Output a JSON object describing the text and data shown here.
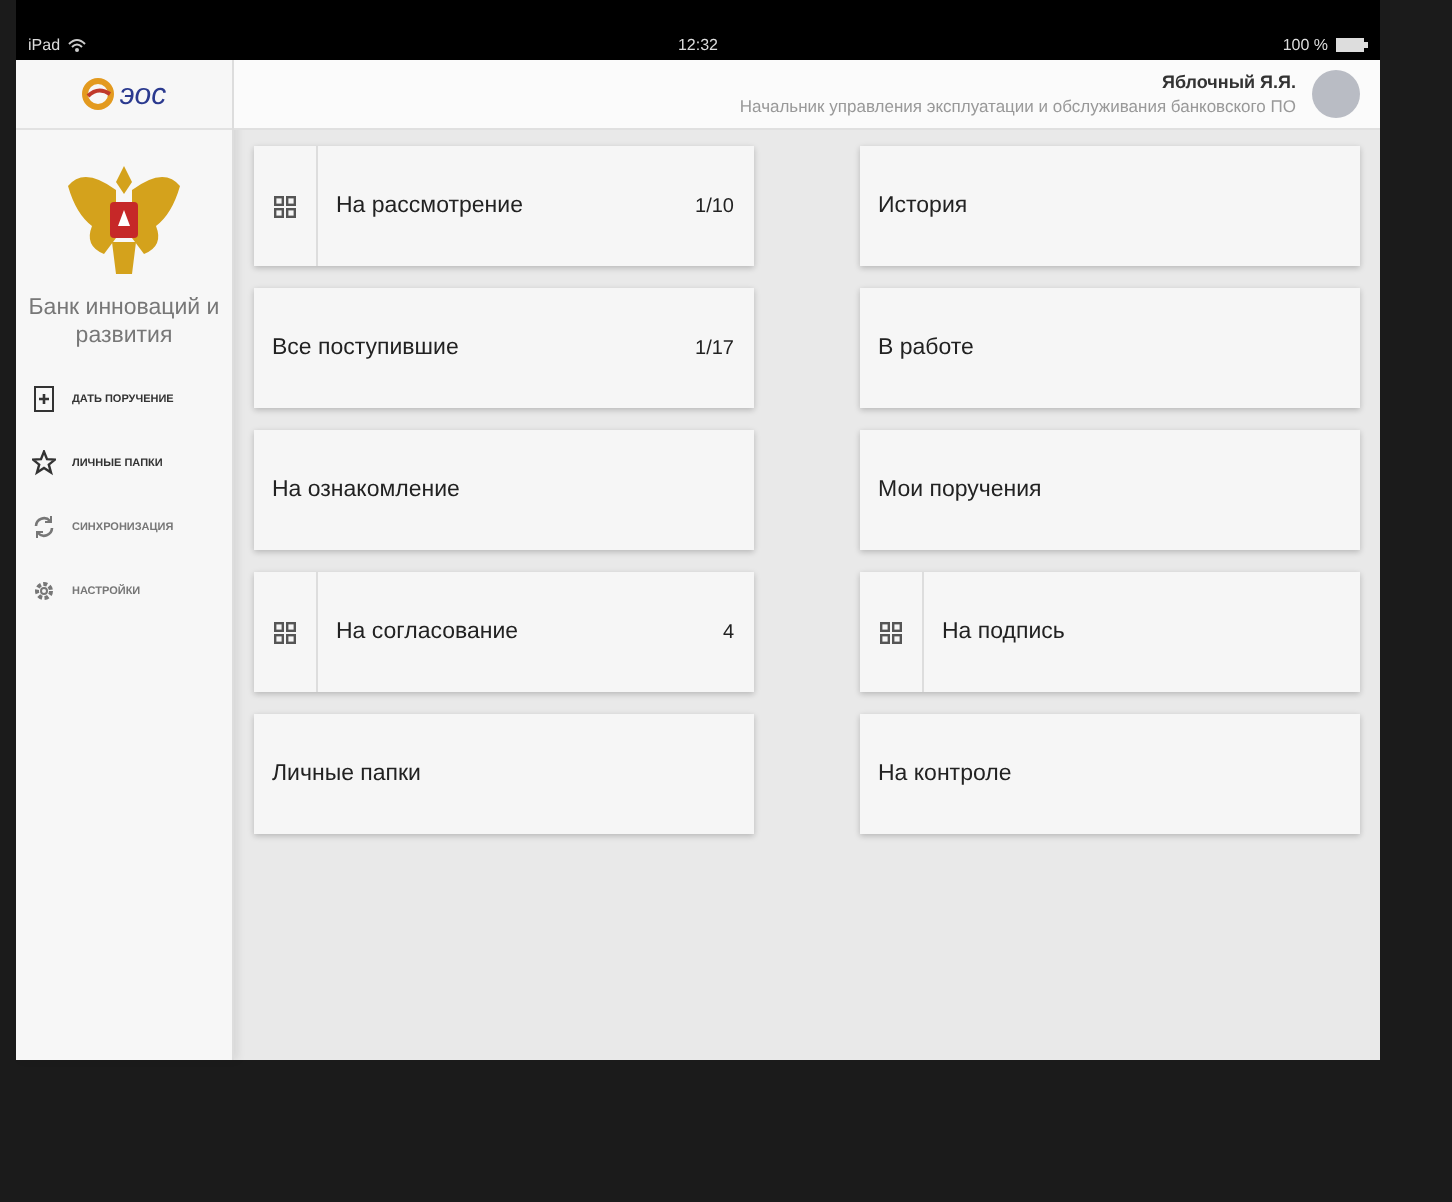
{
  "status_bar": {
    "device": "iPad",
    "time": "12:32",
    "battery": "100 %"
  },
  "header": {
    "logo": "эос",
    "user_name": "Яблочный Я.Я.",
    "user_title": "Начальник управления эксплуатации и обслуживания банковского ПО"
  },
  "sidebar": {
    "org_name": "Банк инноваций и развития",
    "items": [
      {
        "kind": "new",
        "label": "ДАТЬ ПОРУЧЕНИЕ"
      },
      {
        "kind": "star",
        "label": "ЛИЧНЫЕ ПАПКИ"
      },
      {
        "kind": "sync",
        "label": "СИНХРОНИЗАЦИЯ"
      },
      {
        "kind": "settings",
        "label": "НАСТРОЙКИ"
      }
    ]
  },
  "tiles": [
    {
      "kind": "grouped",
      "label": "На рассмотрение",
      "count": "1/10"
    },
    {
      "kind": "plain",
      "label": "История"
    },
    {
      "kind": "plain",
      "label": "Все поступившие",
      "count": "1/17"
    },
    {
      "kind": "plain",
      "label": "В работе"
    },
    {
      "kind": "plain",
      "label": "На ознакомление"
    },
    {
      "kind": "plain",
      "label": "Мои поручения"
    },
    {
      "kind": "grouped",
      "label": "На согласование",
      "count": "4"
    },
    {
      "kind": "grouped",
      "label": "На подпись"
    },
    {
      "kind": "plain",
      "label": "Личные папки"
    },
    {
      "kind": "plain",
      "label": "На контроле"
    }
  ]
}
